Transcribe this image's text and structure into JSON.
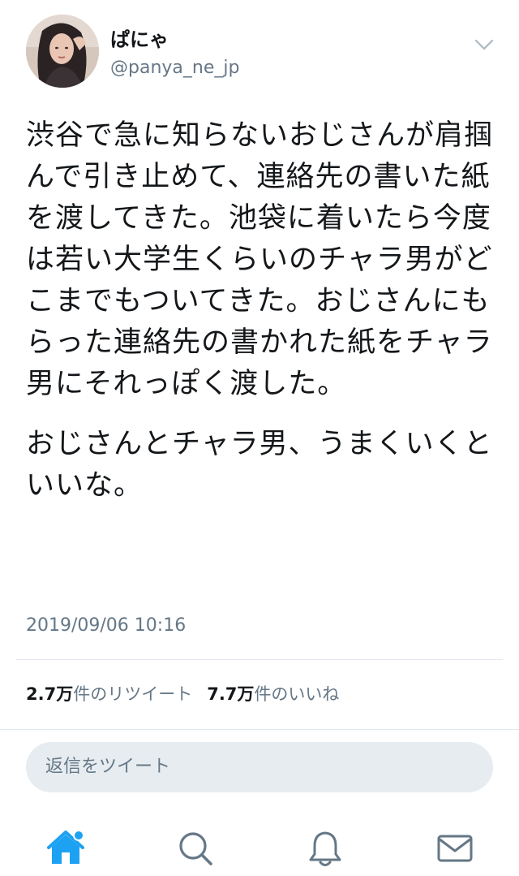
{
  "user": {
    "display_name": "ぱにゃ",
    "handle": "@panya_ne_jp"
  },
  "tweet": {
    "paragraphs": [
      "渋谷で急に知らないおじさんが肩掴んで引き止めて、連絡先の書いた紙を渡してきた。池袋に着いたら今度は若い大学生くらいのチャラ男がどこまでもついてきた。おじさんにもらった連絡先の書かれた紙をチャラ男にそれっぽく渡した。",
      "おじさんとチャラ男、うまくいくといいな。"
    ],
    "timestamp": "2019/09/06 10:16"
  },
  "stats": {
    "retweet_count": "2.7万",
    "retweet_label": "件のリツイート",
    "like_count": "7.7万",
    "like_label": "件のいいね"
  },
  "reply": {
    "placeholder": "返信をツイート"
  },
  "tabbar": {
    "icons": [
      "home-icon",
      "search-icon",
      "notifications-icon",
      "messages-icon"
    ],
    "accent_color": "#1da1f2",
    "icon_color": "#657786"
  }
}
